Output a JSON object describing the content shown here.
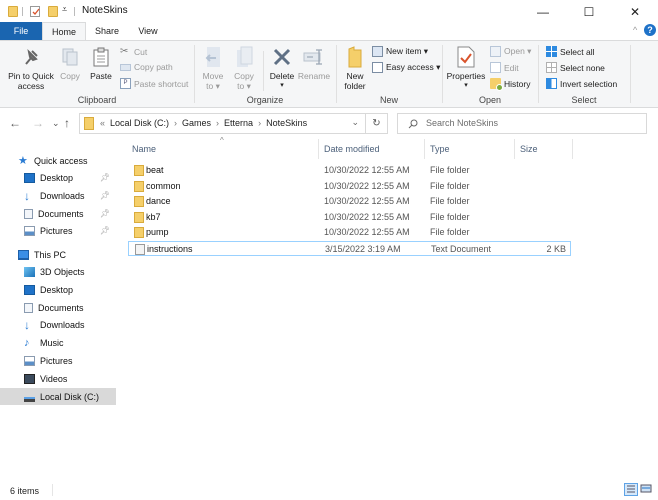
{
  "window": {
    "title": "NoteSkins",
    "controls": {
      "minimize": "—",
      "maximize": "☐",
      "close": "✕"
    }
  },
  "ribbon_tabs": [
    "File",
    "Home",
    "Share",
    "View"
  ],
  "ribbon": {
    "clipboard": {
      "label": "Clipboard",
      "pin": "Pin to Quick access",
      "pin_l1": "Pin to Quick",
      "pin_l2": "access",
      "copy": "Copy",
      "paste": "Paste",
      "cut": "Cut",
      "copy_path": "Copy path",
      "paste_shortcut": "Paste shortcut"
    },
    "organize": {
      "label": "Organize",
      "move_l1": "Move",
      "move_l2": "to ▾",
      "copy_l1": "Copy",
      "copy_l2": "to ▾",
      "delete": "Delete",
      "delete_arrow": "▾",
      "rename": "Rename"
    },
    "new": {
      "label": "New",
      "new_folder_l1": "New",
      "new_folder_l2": "folder",
      "new_item": "New item ▾",
      "easy_access": "Easy access ▾"
    },
    "open": {
      "label": "Open",
      "properties": "Properties",
      "properties_arrow": "▾",
      "open": "Open ▾",
      "edit": "Edit",
      "history": "History"
    },
    "select": {
      "label": "Select",
      "select_all": "Select all",
      "select_none": "Select none",
      "invert": "Invert selection"
    }
  },
  "address": {
    "overflow": "«",
    "crumbs": [
      "Local Disk (C:)",
      "Games",
      "Etterna",
      "NoteSkins"
    ],
    "separator": "›",
    "dropdown": "⌄",
    "refresh": "↻"
  },
  "search": {
    "placeholder": "Search NoteSkins"
  },
  "nav_buttons": {
    "back": "←",
    "forward": "→",
    "recent": "⌄",
    "up": "↑"
  },
  "nav_pane": {
    "quick_access": {
      "label": "Quick access",
      "items": [
        {
          "label": "Desktop",
          "icon": "desktop-icon",
          "pinned": true
        },
        {
          "label": "Downloads",
          "icon": "downloads-icon",
          "pinned": true
        },
        {
          "label": "Documents",
          "icon": "documents-icon",
          "pinned": true
        },
        {
          "label": "Pictures",
          "icon": "pictures-icon",
          "pinned": true
        }
      ]
    },
    "this_pc": {
      "label": "This PC",
      "items": [
        {
          "label": "3D Objects",
          "icon": "3d-objects-icon"
        },
        {
          "label": "Desktop",
          "icon": "desktop-icon"
        },
        {
          "label": "Documents",
          "icon": "documents-icon"
        },
        {
          "label": "Downloads",
          "icon": "downloads-icon"
        },
        {
          "label": "Music",
          "icon": "music-icon"
        },
        {
          "label": "Pictures",
          "icon": "pictures-icon"
        },
        {
          "label": "Videos",
          "icon": "videos-icon"
        },
        {
          "label": "Local Disk (C:)",
          "icon": "drive-icon",
          "selected": true
        }
      ]
    }
  },
  "file_list": {
    "columns": [
      "Name",
      "Date modified",
      "Type",
      "Size"
    ],
    "sort_indicator": "^",
    "rows": [
      {
        "name": "beat",
        "date": "10/30/2022 12:55 AM",
        "type": "File folder",
        "size": "",
        "kind": "folder"
      },
      {
        "name": "common",
        "date": "10/30/2022 12:55 AM",
        "type": "File folder",
        "size": "",
        "kind": "folder"
      },
      {
        "name": "dance",
        "date": "10/30/2022 12:55 AM",
        "type": "File folder",
        "size": "",
        "kind": "folder"
      },
      {
        "name": "kb7",
        "date": "10/30/2022 12:55 AM",
        "type": "File folder",
        "size": "",
        "kind": "folder"
      },
      {
        "name": "pump",
        "date": "10/30/2022 12:55 AM",
        "type": "File folder",
        "size": "",
        "kind": "folder"
      },
      {
        "name": "instructions",
        "date": "3/15/2022 3:19 AM",
        "type": "Text Document",
        "size": "2 KB",
        "kind": "text",
        "selected": true
      }
    ]
  },
  "status_bar": {
    "item_count": "6 items"
  },
  "colors": {
    "file_tab": "#1a65b0",
    "selection_border": "#99d1ff",
    "folder": "#f5cf6a",
    "accent_blue": "#1f72c8"
  }
}
